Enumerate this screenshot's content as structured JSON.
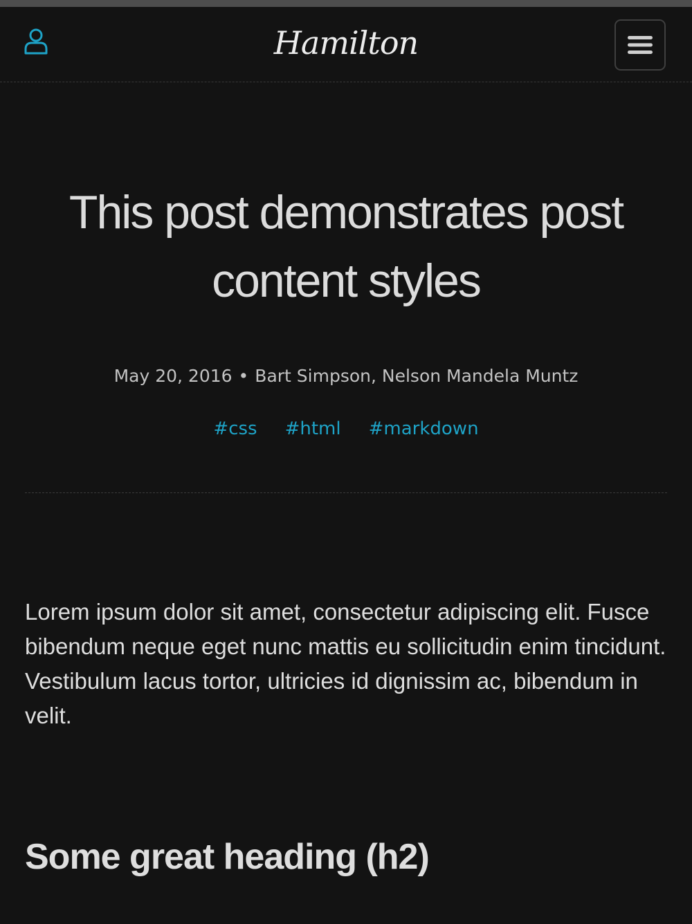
{
  "header": {
    "site_title": "Hamilton",
    "user_icon": "user-icon",
    "menu_icon": "hamburger-menu-icon"
  },
  "colors": {
    "background": "#131313",
    "accent": "#1ea3c7",
    "text": "#dcdcdc",
    "muted": "#c3c3c3",
    "border": "#3a3a3a"
  },
  "post": {
    "title": "This post demonstrates post content styles",
    "date": "May 20, 2016",
    "separator": "•",
    "authors": "Bart Simpson, Nelson Mandela Muntz",
    "tags": [
      "#css",
      "#html",
      "#markdown"
    ],
    "paragraph": "Lorem ipsum dolor sit amet, consectetur adipiscing elit. Fusce bibendum neque eget nunc mattis eu sollicitudin enim tincidunt. Vestibulum lacus tortor, ultricies id dignis­sim ac, bibendum in velit.",
    "heading_h2": "Some great heading (h2)"
  }
}
